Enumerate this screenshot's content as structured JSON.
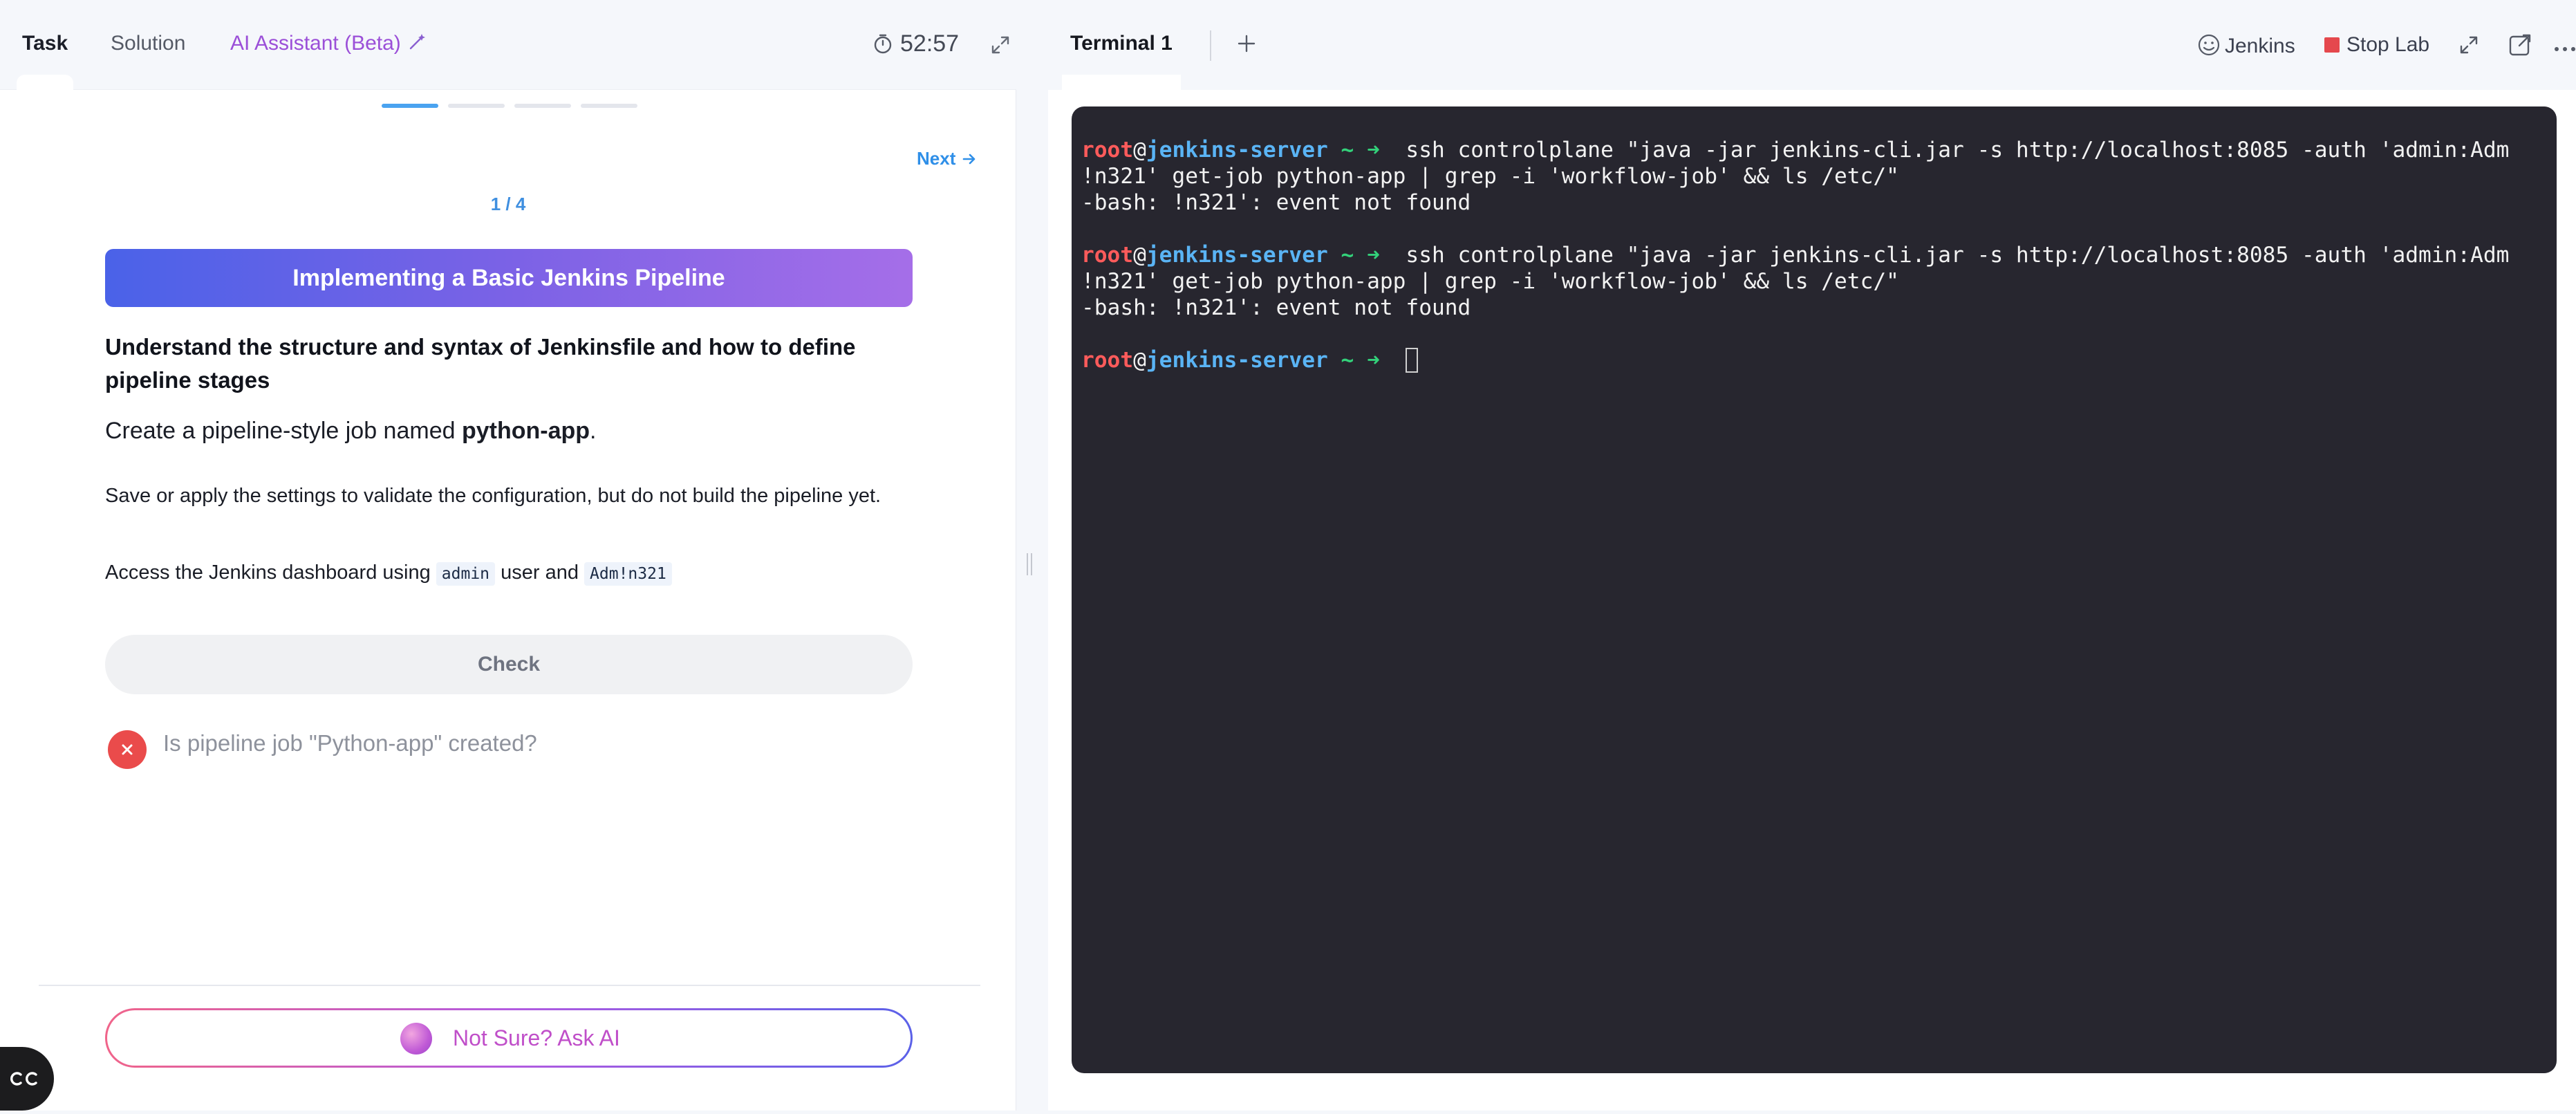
{
  "left_tabs": {
    "task": "Task",
    "solution": "Solution",
    "ai_assistant": "AI Assistant (Beta)"
  },
  "timer": "52:57",
  "progress": {
    "step_label": "1 / 4",
    "current_step": 1,
    "total_steps": 4,
    "active_color": "#4aa3f0",
    "inactive_color": "#e4e6ec"
  },
  "nav": {
    "next_label": "Next"
  },
  "task": {
    "title": "Implementing a Basic Jenkins Pipeline",
    "heading": "Understand the structure and syntax of Jenkinsfile and how to define pipeline stages",
    "create_prefix": "Create a pipeline-style job named ",
    "job_name": "python-app",
    "create_suffix": ".",
    "save_text": "Save or apply the settings to validate the configuration, but do not build the pipeline yet.",
    "access_prefix": "Access the Jenkins dashboard using ",
    "access_user": "admin",
    "access_mid": " user and ",
    "access_password": "Adm!n321"
  },
  "check": {
    "button_label": "Check",
    "results": [
      {
        "status": "failed",
        "text": "Is pipeline job \"Python-app\" created?"
      }
    ]
  },
  "ask_ai": {
    "label": "Not Sure? Ask AI"
  },
  "terminal_tabs": {
    "active": "Terminal 1"
  },
  "toolbar": {
    "jenkins_label": "Jenkins",
    "stop_lab_label": "Stop Lab",
    "stop_color": "#e5484d"
  },
  "terminal": {
    "lines": [
      {
        "user": "root",
        "at": "@",
        "host": "jenkins-server",
        "tail": " ~ ➜",
        "cmd": "  ssh controlplane \"java -jar jenkins-cli.jar -s http://localhost:8085 -auth 'admin:Adm"
      },
      {
        "text": "!n321' get-job python-app | grep -i 'workflow-job' && ls /etc/\""
      },
      {
        "text": "-bash: !n321': event not found"
      },
      {
        "blank": true
      },
      {
        "user": "root",
        "at": "@",
        "host": "jenkins-server",
        "tail": " ~ ➜",
        "cmd": "  ssh controlplane \"java -jar jenkins-cli.jar -s http://localhost:8085 -auth 'admin:Adm"
      },
      {
        "text": "!n321' get-job python-app | grep -i 'workflow-job' && ls /etc/\""
      },
      {
        "text": "-bash: !n321': event not found"
      },
      {
        "blank": true
      },
      {
        "user": "root",
        "at": "@",
        "host": "jenkins-server",
        "tail": " ~ ➜",
        "cmd": "  ",
        "cursor": true
      }
    ]
  },
  "icons": {
    "timer": "stopwatch-icon",
    "expand": "expand-icon",
    "add": "plus-icon",
    "jenkins": "jenkins-logo-icon",
    "popout": "external-link-icon",
    "more": "more-horizontal-icon",
    "failed": "x-circle-icon"
  }
}
